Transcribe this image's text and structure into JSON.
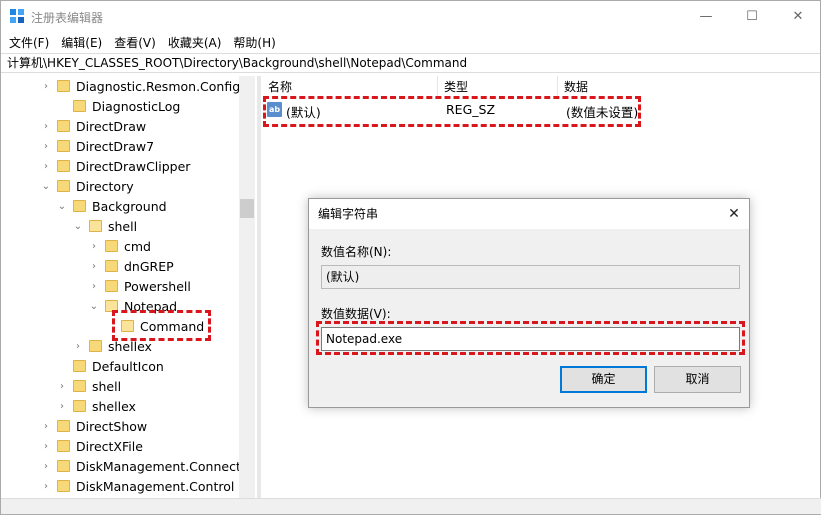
{
  "window": {
    "title": "注册表编辑器",
    "controls": {
      "minimize": "—",
      "maximize": "☐",
      "close": "✕"
    }
  },
  "menu": [
    "文件(F)",
    "编辑(E)",
    "查看(V)",
    "收藏夹(A)",
    "帮助(H)"
  ],
  "address": "计算机\\HKEY_CLASSES_ROOT\\Directory\\Background\\shell\\Notepad\\Command",
  "tree": [
    {
      "label": "Diagnostic.Resmon.Config",
      "expander": "›",
      "open": false
    },
    {
      "label": "DiagnosticLog",
      "expander": "",
      "open": false
    },
    {
      "label": "DirectDraw",
      "expander": "›",
      "open": false
    },
    {
      "label": "DirectDraw7",
      "expander": "›",
      "open": false
    },
    {
      "label": "DirectDrawClipper",
      "expander": "›",
      "open": false
    },
    {
      "label": "Directory",
      "expander": "⌄",
      "open": false
    },
    {
      "label": "Background",
      "expander": "⌄",
      "open": false
    },
    {
      "label": "shell",
      "expander": "⌄",
      "open": true
    },
    {
      "label": "cmd",
      "expander": "›",
      "open": false
    },
    {
      "label": "dnGREP",
      "expander": "›",
      "open": false
    },
    {
      "label": "Powershell",
      "expander": "›",
      "open": false
    },
    {
      "label": "Notepad",
      "expander": "⌄",
      "open": true
    },
    {
      "label": "Command",
      "expander": "",
      "open": true
    },
    {
      "label": "shellex",
      "expander": "›",
      "open": false
    },
    {
      "label": "DefaultIcon",
      "expander": "",
      "open": false
    },
    {
      "label": "shell",
      "expander": "›",
      "open": false
    },
    {
      "label": "shellex",
      "expander": "›",
      "open": false
    },
    {
      "label": "DirectShow",
      "expander": "›",
      "open": false
    },
    {
      "label": "DirectXFile",
      "expander": "›",
      "open": false
    },
    {
      "label": "DiskManagement.Connectio",
      "expander": "›",
      "open": false
    },
    {
      "label": "DiskManagement.Control",
      "expander": "›",
      "open": false
    }
  ],
  "list": {
    "headers": {
      "name": "名称",
      "type": "类型",
      "data": "数据"
    },
    "rows": [
      {
        "icon": "ab",
        "name": "(默认)",
        "type": "REG_SZ",
        "data": "(数值未设置)"
      }
    ]
  },
  "dialog": {
    "title": "编辑字符串",
    "close": "✕",
    "name_label": "数值名称(N):",
    "name_value": "(默认)",
    "data_label": "数值数据(V):",
    "data_value": "Notepad.exe",
    "ok_label": "确定",
    "cancel_label": "取消"
  },
  "colors": {
    "highlight_box": "#d8161b",
    "folder": "#f7d97a",
    "accent": "#0078d7"
  }
}
